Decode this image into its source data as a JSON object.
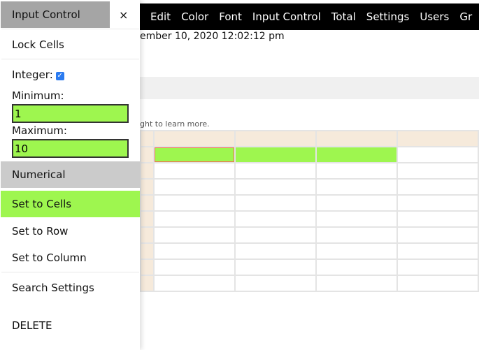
{
  "menubar": {
    "items": [
      "Edit",
      "Color",
      "Font",
      "Input Control",
      "Total",
      "Settings",
      "Users",
      "Gr"
    ]
  },
  "date_text": "ember 10, 2020 12:02:12 pm",
  "hint_text": "ght to learn more.",
  "panel": {
    "title": "Input Control",
    "close": "×",
    "lock_cells": "Lock Cells",
    "integer_label": "Integer:",
    "integer_checked": true,
    "minimum_label": "Minimum:",
    "minimum_value": "1",
    "maximum_label": "Maximum:",
    "maximum_value": "10",
    "numerical": "Numerical",
    "set_cells": "Set to Cells",
    "set_row": "Set to Row",
    "set_column": "Set to Column",
    "search_settings": "Search Settings",
    "delete": "DELETE"
  },
  "colors": {
    "accent_green": "#9ef64f",
    "header_beige": "#f6eadb",
    "selected_border": "#f07050"
  }
}
